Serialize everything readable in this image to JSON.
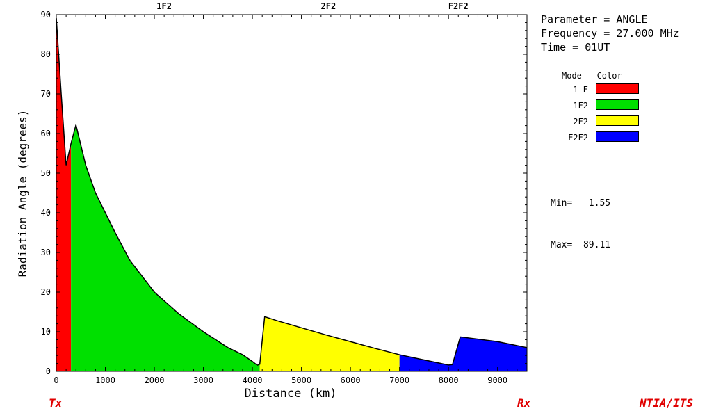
{
  "chart_data": {
    "type": "area",
    "xlabel": "Distance (km)",
    "ylabel": "Radiation Angle (degrees)",
    "xlim": [
      0,
      9600
    ],
    "ylim": [
      0,
      90
    ],
    "x_ticks": [
      0,
      1000,
      2000,
      3000,
      4000,
      5000,
      6000,
      7000,
      8000,
      9000
    ],
    "y_ticks": [
      0,
      10,
      20,
      30,
      40,
      50,
      60,
      70,
      80,
      90
    ],
    "top_labels": [
      {
        "text": "1F2",
        "x": 2200
      },
      {
        "text": "2F2",
        "x": 5550
      },
      {
        "text": "F2F2",
        "x": 8200
      }
    ],
    "series": [
      {
        "name": "1 E",
        "color": "#ff0000",
        "points": [
          [
            0,
            89.11
          ],
          [
            100,
            70
          ],
          [
            200,
            52
          ],
          [
            300,
            57.5
          ]
        ]
      },
      {
        "name": "1F2",
        "color": "#00e000",
        "points": [
          [
            300,
            57.5
          ],
          [
            400,
            62.2
          ],
          [
            600,
            52
          ],
          [
            800,
            45
          ],
          [
            1000,
            40
          ],
          [
            1200,
            35
          ],
          [
            1500,
            28
          ],
          [
            2000,
            20
          ],
          [
            2500,
            14.5
          ],
          [
            3000,
            10
          ],
          [
            3500,
            6
          ],
          [
            3800,
            4.2
          ],
          [
            4000,
            2.5
          ],
          [
            4100,
            1.55
          ],
          [
            4150,
            1.8
          ]
        ]
      },
      {
        "name": "2F2",
        "color": "#ffff00",
        "points": [
          [
            4150,
            1.8
          ],
          [
            4250,
            13.8
          ],
          [
            4500,
            12.8
          ],
          [
            5000,
            11
          ],
          [
            5500,
            9.2
          ],
          [
            6000,
            7.5
          ],
          [
            6500,
            5.8
          ],
          [
            7000,
            4.2
          ]
        ]
      },
      {
        "name": "F2F2",
        "color": "#0000ff",
        "points": [
          [
            7000,
            4.2
          ],
          [
            7500,
            2.9
          ],
          [
            8000,
            1.6
          ],
          [
            8080,
            1.7
          ],
          [
            8240,
            8.7
          ],
          [
            8500,
            8.3
          ],
          [
            9000,
            7.5
          ],
          [
            9600,
            6.0
          ]
        ]
      }
    ]
  },
  "info": {
    "parameter": "Parameter = ANGLE",
    "frequency": "Frequency = 27.000 MHz",
    "time": "Time = 01UT"
  },
  "legend": {
    "header": "Mode   Color",
    "items": [
      {
        "mode": "1 E",
        "color": "#ff0000"
      },
      {
        "mode": "1F2",
        "color": "#00e000"
      },
      {
        "mode": "2F2",
        "color": "#ffff00"
      },
      {
        "mode": "F2F2",
        "color": "#0000ff"
      }
    ]
  },
  "stats": {
    "min": "Min=   1.55",
    "max": "Max=  89.11"
  },
  "corners": {
    "tx": "Tx",
    "rx": "Rx",
    "org": "NTIA/ITS"
  }
}
